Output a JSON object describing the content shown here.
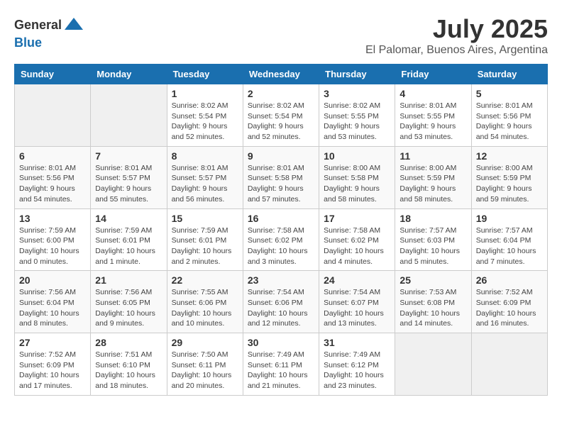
{
  "header": {
    "logo_general": "General",
    "logo_blue": "Blue",
    "month_year": "July 2025",
    "location": "El Palomar, Buenos Aires, Argentina"
  },
  "days_of_week": [
    "Sunday",
    "Monday",
    "Tuesday",
    "Wednesday",
    "Thursday",
    "Friday",
    "Saturday"
  ],
  "weeks": [
    [
      {
        "day": "",
        "empty": true
      },
      {
        "day": "",
        "empty": true
      },
      {
        "day": "1",
        "sunrise": "Sunrise: 8:02 AM",
        "sunset": "Sunset: 5:54 PM",
        "daylight": "Daylight: 9 hours and 52 minutes."
      },
      {
        "day": "2",
        "sunrise": "Sunrise: 8:02 AM",
        "sunset": "Sunset: 5:54 PM",
        "daylight": "Daylight: 9 hours and 52 minutes."
      },
      {
        "day": "3",
        "sunrise": "Sunrise: 8:02 AM",
        "sunset": "Sunset: 5:55 PM",
        "daylight": "Daylight: 9 hours and 53 minutes."
      },
      {
        "day": "4",
        "sunrise": "Sunrise: 8:01 AM",
        "sunset": "Sunset: 5:55 PM",
        "daylight": "Daylight: 9 hours and 53 minutes."
      },
      {
        "day": "5",
        "sunrise": "Sunrise: 8:01 AM",
        "sunset": "Sunset: 5:56 PM",
        "daylight": "Daylight: 9 hours and 54 minutes."
      }
    ],
    [
      {
        "day": "6",
        "sunrise": "Sunrise: 8:01 AM",
        "sunset": "Sunset: 5:56 PM",
        "daylight": "Daylight: 9 hours and 54 minutes."
      },
      {
        "day": "7",
        "sunrise": "Sunrise: 8:01 AM",
        "sunset": "Sunset: 5:57 PM",
        "daylight": "Daylight: 9 hours and 55 minutes."
      },
      {
        "day": "8",
        "sunrise": "Sunrise: 8:01 AM",
        "sunset": "Sunset: 5:57 PM",
        "daylight": "Daylight: 9 hours and 56 minutes."
      },
      {
        "day": "9",
        "sunrise": "Sunrise: 8:01 AM",
        "sunset": "Sunset: 5:58 PM",
        "daylight": "Daylight: 9 hours and 57 minutes."
      },
      {
        "day": "10",
        "sunrise": "Sunrise: 8:00 AM",
        "sunset": "Sunset: 5:58 PM",
        "daylight": "Daylight: 9 hours and 58 minutes."
      },
      {
        "day": "11",
        "sunrise": "Sunrise: 8:00 AM",
        "sunset": "Sunset: 5:59 PM",
        "daylight": "Daylight: 9 hours and 58 minutes."
      },
      {
        "day": "12",
        "sunrise": "Sunrise: 8:00 AM",
        "sunset": "Sunset: 5:59 PM",
        "daylight": "Daylight: 9 hours and 59 minutes."
      }
    ],
    [
      {
        "day": "13",
        "sunrise": "Sunrise: 7:59 AM",
        "sunset": "Sunset: 6:00 PM",
        "daylight": "Daylight: 10 hours and 0 minutes."
      },
      {
        "day": "14",
        "sunrise": "Sunrise: 7:59 AM",
        "sunset": "Sunset: 6:01 PM",
        "daylight": "Daylight: 10 hours and 1 minute."
      },
      {
        "day": "15",
        "sunrise": "Sunrise: 7:59 AM",
        "sunset": "Sunset: 6:01 PM",
        "daylight": "Daylight: 10 hours and 2 minutes."
      },
      {
        "day": "16",
        "sunrise": "Sunrise: 7:58 AM",
        "sunset": "Sunset: 6:02 PM",
        "daylight": "Daylight: 10 hours and 3 minutes."
      },
      {
        "day": "17",
        "sunrise": "Sunrise: 7:58 AM",
        "sunset": "Sunset: 6:02 PM",
        "daylight": "Daylight: 10 hours and 4 minutes."
      },
      {
        "day": "18",
        "sunrise": "Sunrise: 7:57 AM",
        "sunset": "Sunset: 6:03 PM",
        "daylight": "Daylight: 10 hours and 5 minutes."
      },
      {
        "day": "19",
        "sunrise": "Sunrise: 7:57 AM",
        "sunset": "Sunset: 6:04 PM",
        "daylight": "Daylight: 10 hours and 7 minutes."
      }
    ],
    [
      {
        "day": "20",
        "sunrise": "Sunrise: 7:56 AM",
        "sunset": "Sunset: 6:04 PM",
        "daylight": "Daylight: 10 hours and 8 minutes."
      },
      {
        "day": "21",
        "sunrise": "Sunrise: 7:56 AM",
        "sunset": "Sunset: 6:05 PM",
        "daylight": "Daylight: 10 hours and 9 minutes."
      },
      {
        "day": "22",
        "sunrise": "Sunrise: 7:55 AM",
        "sunset": "Sunset: 6:06 PM",
        "daylight": "Daylight: 10 hours and 10 minutes."
      },
      {
        "day": "23",
        "sunrise": "Sunrise: 7:54 AM",
        "sunset": "Sunset: 6:06 PM",
        "daylight": "Daylight: 10 hours and 12 minutes."
      },
      {
        "day": "24",
        "sunrise": "Sunrise: 7:54 AM",
        "sunset": "Sunset: 6:07 PM",
        "daylight": "Daylight: 10 hours and 13 minutes."
      },
      {
        "day": "25",
        "sunrise": "Sunrise: 7:53 AM",
        "sunset": "Sunset: 6:08 PM",
        "daylight": "Daylight: 10 hours and 14 minutes."
      },
      {
        "day": "26",
        "sunrise": "Sunrise: 7:52 AM",
        "sunset": "Sunset: 6:09 PM",
        "daylight": "Daylight: 10 hours and 16 minutes."
      }
    ],
    [
      {
        "day": "27",
        "sunrise": "Sunrise: 7:52 AM",
        "sunset": "Sunset: 6:09 PM",
        "daylight": "Daylight: 10 hours and 17 minutes."
      },
      {
        "day": "28",
        "sunrise": "Sunrise: 7:51 AM",
        "sunset": "Sunset: 6:10 PM",
        "daylight": "Daylight: 10 hours and 18 minutes."
      },
      {
        "day": "29",
        "sunrise": "Sunrise: 7:50 AM",
        "sunset": "Sunset: 6:11 PM",
        "daylight": "Daylight: 10 hours and 20 minutes."
      },
      {
        "day": "30",
        "sunrise": "Sunrise: 7:49 AM",
        "sunset": "Sunset: 6:11 PM",
        "daylight": "Daylight: 10 hours and 21 minutes."
      },
      {
        "day": "31",
        "sunrise": "Sunrise: 7:49 AM",
        "sunset": "Sunset: 6:12 PM",
        "daylight": "Daylight: 10 hours and 23 minutes."
      },
      {
        "day": "",
        "empty": true
      },
      {
        "day": "",
        "empty": true
      }
    ]
  ]
}
